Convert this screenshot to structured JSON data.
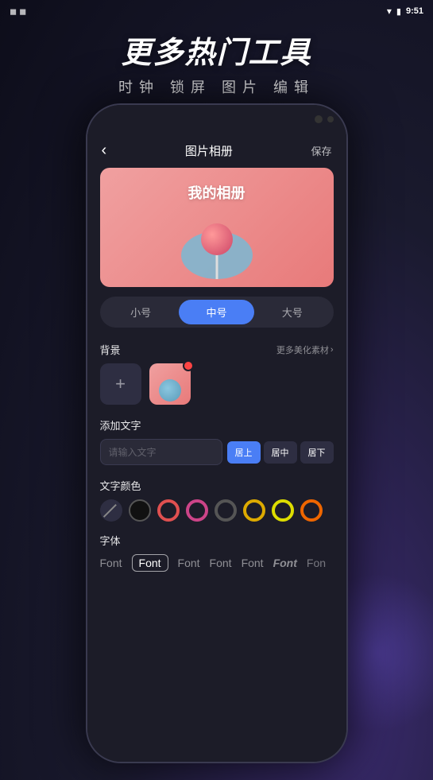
{
  "statusBar": {
    "time": "9:51",
    "icons": [
      "signal",
      "wifi",
      "battery"
    ]
  },
  "hero": {
    "title": "更多热门工具",
    "subtitle": "时钟 锁屏 图片 编辑"
  },
  "phone": {
    "appHeader": {
      "backLabel": "‹",
      "title": "图片相册",
      "saveLabel": "保存"
    },
    "previewTitle": "我的相册",
    "sizeSelector": {
      "options": [
        "小号",
        "中号",
        "大号"
      ],
      "activeIndex": 1
    },
    "backgroundSection": {
      "label": "背景",
      "moreLabel": "更多美化素材",
      "moreIcon": "›"
    },
    "textSection": {
      "label": "添加文字",
      "inputPlaceholder": "请输入文字",
      "alignButtons": [
        "居上",
        "居中",
        "居下"
      ],
      "activeAlign": 0
    },
    "colorSection": {
      "label": "文字颜色",
      "colors": [
        {
          "type": "slash",
          "color": "#555"
        },
        {
          "type": "filled",
          "color": "#222"
        },
        {
          "type": "ring",
          "color": "#e05050"
        },
        {
          "type": "ring",
          "color": "#cc4488"
        },
        {
          "type": "ring",
          "color": "#333"
        },
        {
          "type": "ring",
          "color": "#ddaa00"
        },
        {
          "type": "ring",
          "color": "#dddd00"
        },
        {
          "type": "ring",
          "color": "#ee6600"
        }
      ]
    },
    "fontSection": {
      "label": "字体",
      "fonts": [
        {
          "label": "Font",
          "style": "normal",
          "active": false
        },
        {
          "label": "Font",
          "style": "selected-box",
          "active": true
        },
        {
          "label": "Font",
          "style": "light",
          "active": false
        },
        {
          "label": "Font",
          "style": "normal",
          "active": false
        },
        {
          "label": "Font",
          "style": "normal",
          "active": false
        },
        {
          "label": "Font",
          "style": "bold-italic",
          "active": false
        },
        {
          "label": "Font",
          "style": "partial",
          "active": false
        }
      ]
    }
  }
}
